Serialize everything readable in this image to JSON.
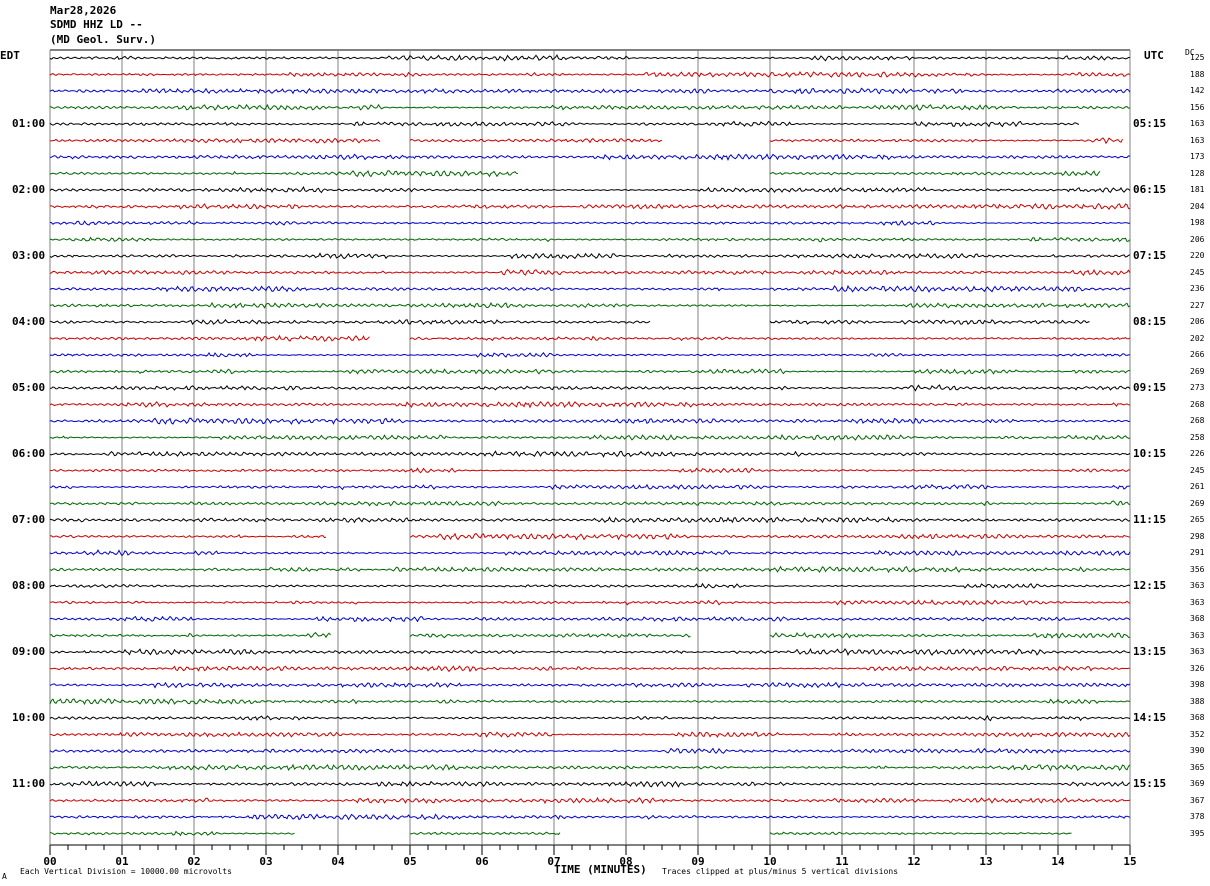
{
  "header": {
    "date": "Mar28,2026",
    "station": "SDMD HHZ LD --",
    "agency": "(MD Geol. Surv.)"
  },
  "labels": {
    "left_timezone": "EDT",
    "right_timezone": "UTC",
    "dc_label": "DC"
  },
  "footer": {
    "scale_note": "Each Vertical Division = 10000.00 microvolts",
    "xaxis_title": "TIME (MINUTES)",
    "clip_note": "Traces clipped at plus/minus 5 vertical divisions",
    "corner_mark": "A"
  },
  "colors": {
    "cycle": [
      "#000000",
      "#cc0000",
      "#0000cc",
      "#006600"
    ],
    "grid": "#808080"
  },
  "chart_data": {
    "type": "line",
    "xlabel": "TIME (MINUTES)",
    "xlim": [
      0,
      15
    ],
    "x_ticks": [
      "00",
      "01",
      "02",
      "03",
      "04",
      "05",
      "06",
      "07",
      "08",
      "09",
      "10",
      "11",
      "12",
      "13",
      "14",
      "15"
    ],
    "left_hour_labels": [
      "01:00",
      "02:00",
      "03:00",
      "04:00",
      "05:00",
      "06:00",
      "07:00",
      "08:00",
      "09:00",
      "10:00",
      "11:00"
    ],
    "right_hour_labels": [
      "05:15",
      "06:15",
      "07:15",
      "08:15",
      "09:15",
      "10:15",
      "11:15",
      "12:15",
      "13:15",
      "14:15",
      "15:15"
    ],
    "dc_offsets": [
      125,
      188,
      142,
      156,
      163,
      163,
      173,
      128,
      181,
      204,
      198,
      206,
      220,
      245,
      236,
      227,
      206,
      202,
      266,
      269,
      273,
      268,
      268,
      258,
      226,
      245,
      261,
      269,
      265,
      298,
      291,
      356,
      363,
      363,
      368,
      363,
      363,
      326,
      398,
      388,
      368,
      352,
      390,
      365,
      369,
      367,
      378,
      395
    ],
    "gaps": [
      {
        "line": 0,
        "segments": [
          [
            0,
            15
          ]
        ]
      },
      {
        "line": 4,
        "segments": [
          [
            0,
            14.3
          ]
        ]
      },
      {
        "line": 5,
        "segments": [
          [
            0,
            4.6
          ],
          [
            5.0,
            8.5
          ],
          [
            10.0,
            14.9
          ]
        ]
      },
      {
        "line": 7,
        "segments": [
          [
            0,
            6.5
          ],
          [
            10.0,
            14.6
          ]
        ]
      },
      {
        "line": 16,
        "segments": [
          [
            0,
            8.35
          ],
          [
            10.0,
            14.45
          ]
        ]
      },
      {
        "line": 17,
        "segments": [
          [
            0,
            4.45
          ],
          [
            5.0,
            15
          ]
        ]
      },
      {
        "line": 29,
        "segments": [
          [
            0,
            3.85
          ],
          [
            5.0,
            15
          ]
        ]
      },
      {
        "line": 35,
        "segments": [
          [
            0,
            3.9
          ],
          [
            5.0,
            8.9
          ],
          [
            10.0,
            15
          ]
        ]
      },
      {
        "line": 47,
        "segments": [
          [
            0,
            3.4
          ],
          [
            5.0,
            7.1
          ],
          [
            10.0,
            14.2
          ]
        ]
      }
    ]
  }
}
